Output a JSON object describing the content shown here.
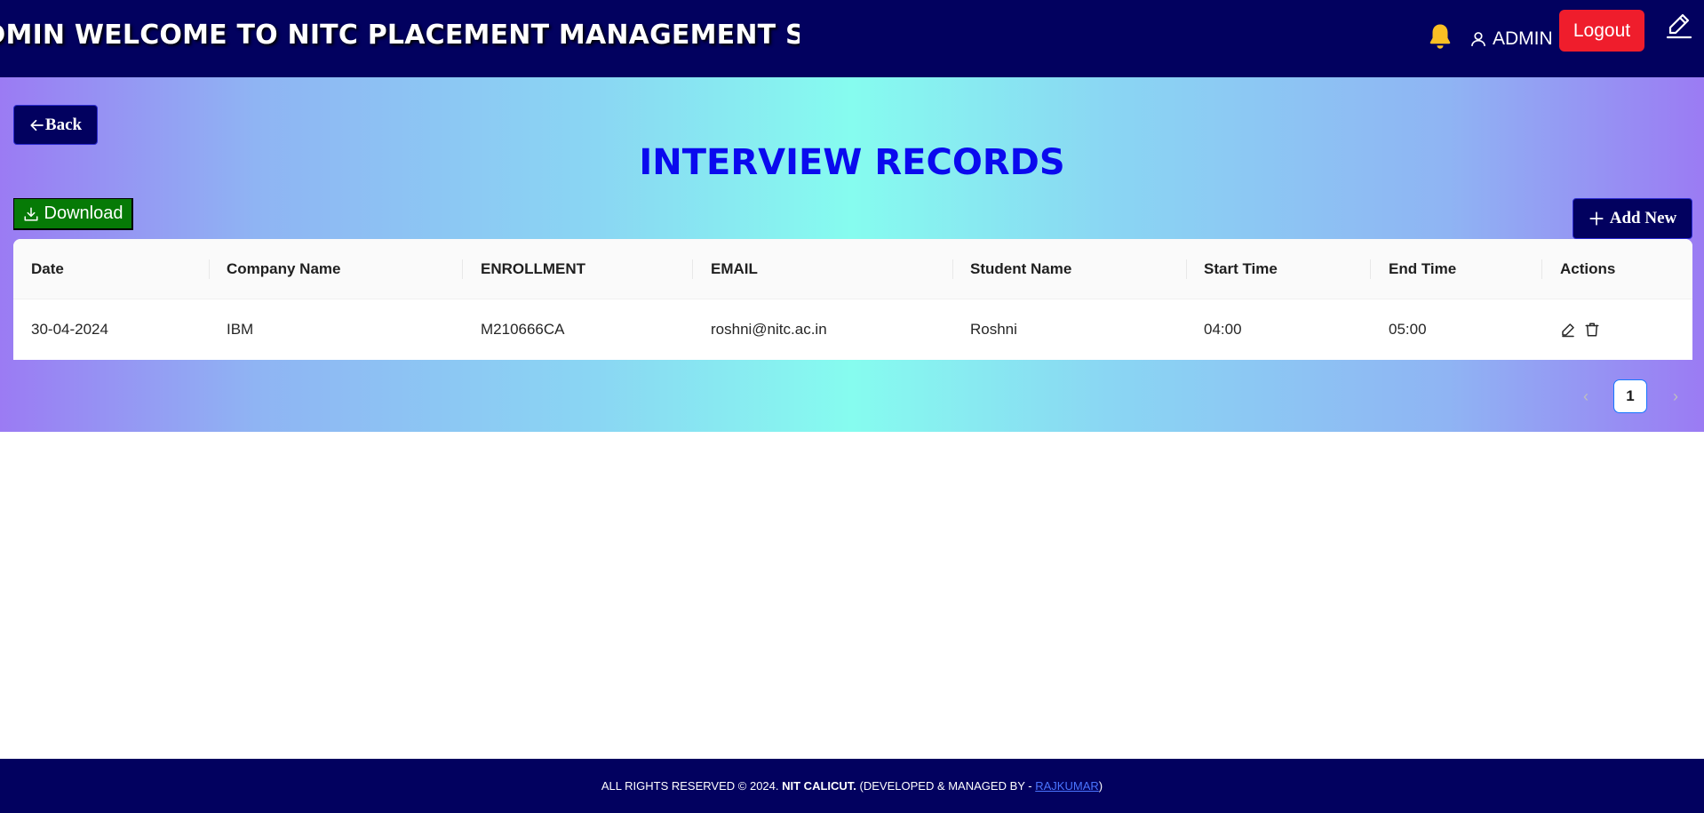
{
  "header": {
    "marquee": "ADMIN WELCOME TO NITC PLACEMENT MANAGEMENT SYSTEM",
    "user_label": "ADMIN",
    "logout_label": "Logout"
  },
  "page": {
    "back_label": "Back",
    "title": "INTERVIEW RECORDS",
    "download_label": "Download",
    "add_new_label": "Add New"
  },
  "table": {
    "columns": [
      "Date",
      "Company Name",
      "ENROLLMENT",
      "EMAIL",
      "Student Name",
      "Start Time",
      "End Time",
      "Actions"
    ],
    "rows": [
      {
        "date": "30-04-2024",
        "company": "IBM",
        "enrollment": "M210666CA",
        "email": "roshni@nitc.ac.in",
        "student": "Roshni",
        "start": "04:00",
        "end": "05:00"
      }
    ]
  },
  "pagination": {
    "current_page": "1",
    "prev_symbol": "‹",
    "next_symbol": "›"
  },
  "footer": {
    "rights": "ALL RIGHTS RESERVED © 2024.",
    "org": "NIT CALICUT.",
    "dev_prefix": "(DEVELOPED & MANAGED BY -",
    "developer": "RAJKUMAR",
    "dev_suffix": ")"
  },
  "colors": {
    "navy": "#02015f",
    "logout_red": "#ef1d2c",
    "title_blue": "#0a0aee",
    "download_green": "#067a06",
    "bell_gold": "#fbbf24"
  },
  "icons": {
    "bell": "bell-icon",
    "user": "user-icon",
    "edit_top": "pencil-icon",
    "back": "arrow-left-icon",
    "download": "download-icon",
    "add": "plus-icon",
    "row_edit": "edit-icon",
    "row_delete": "trash-icon"
  }
}
